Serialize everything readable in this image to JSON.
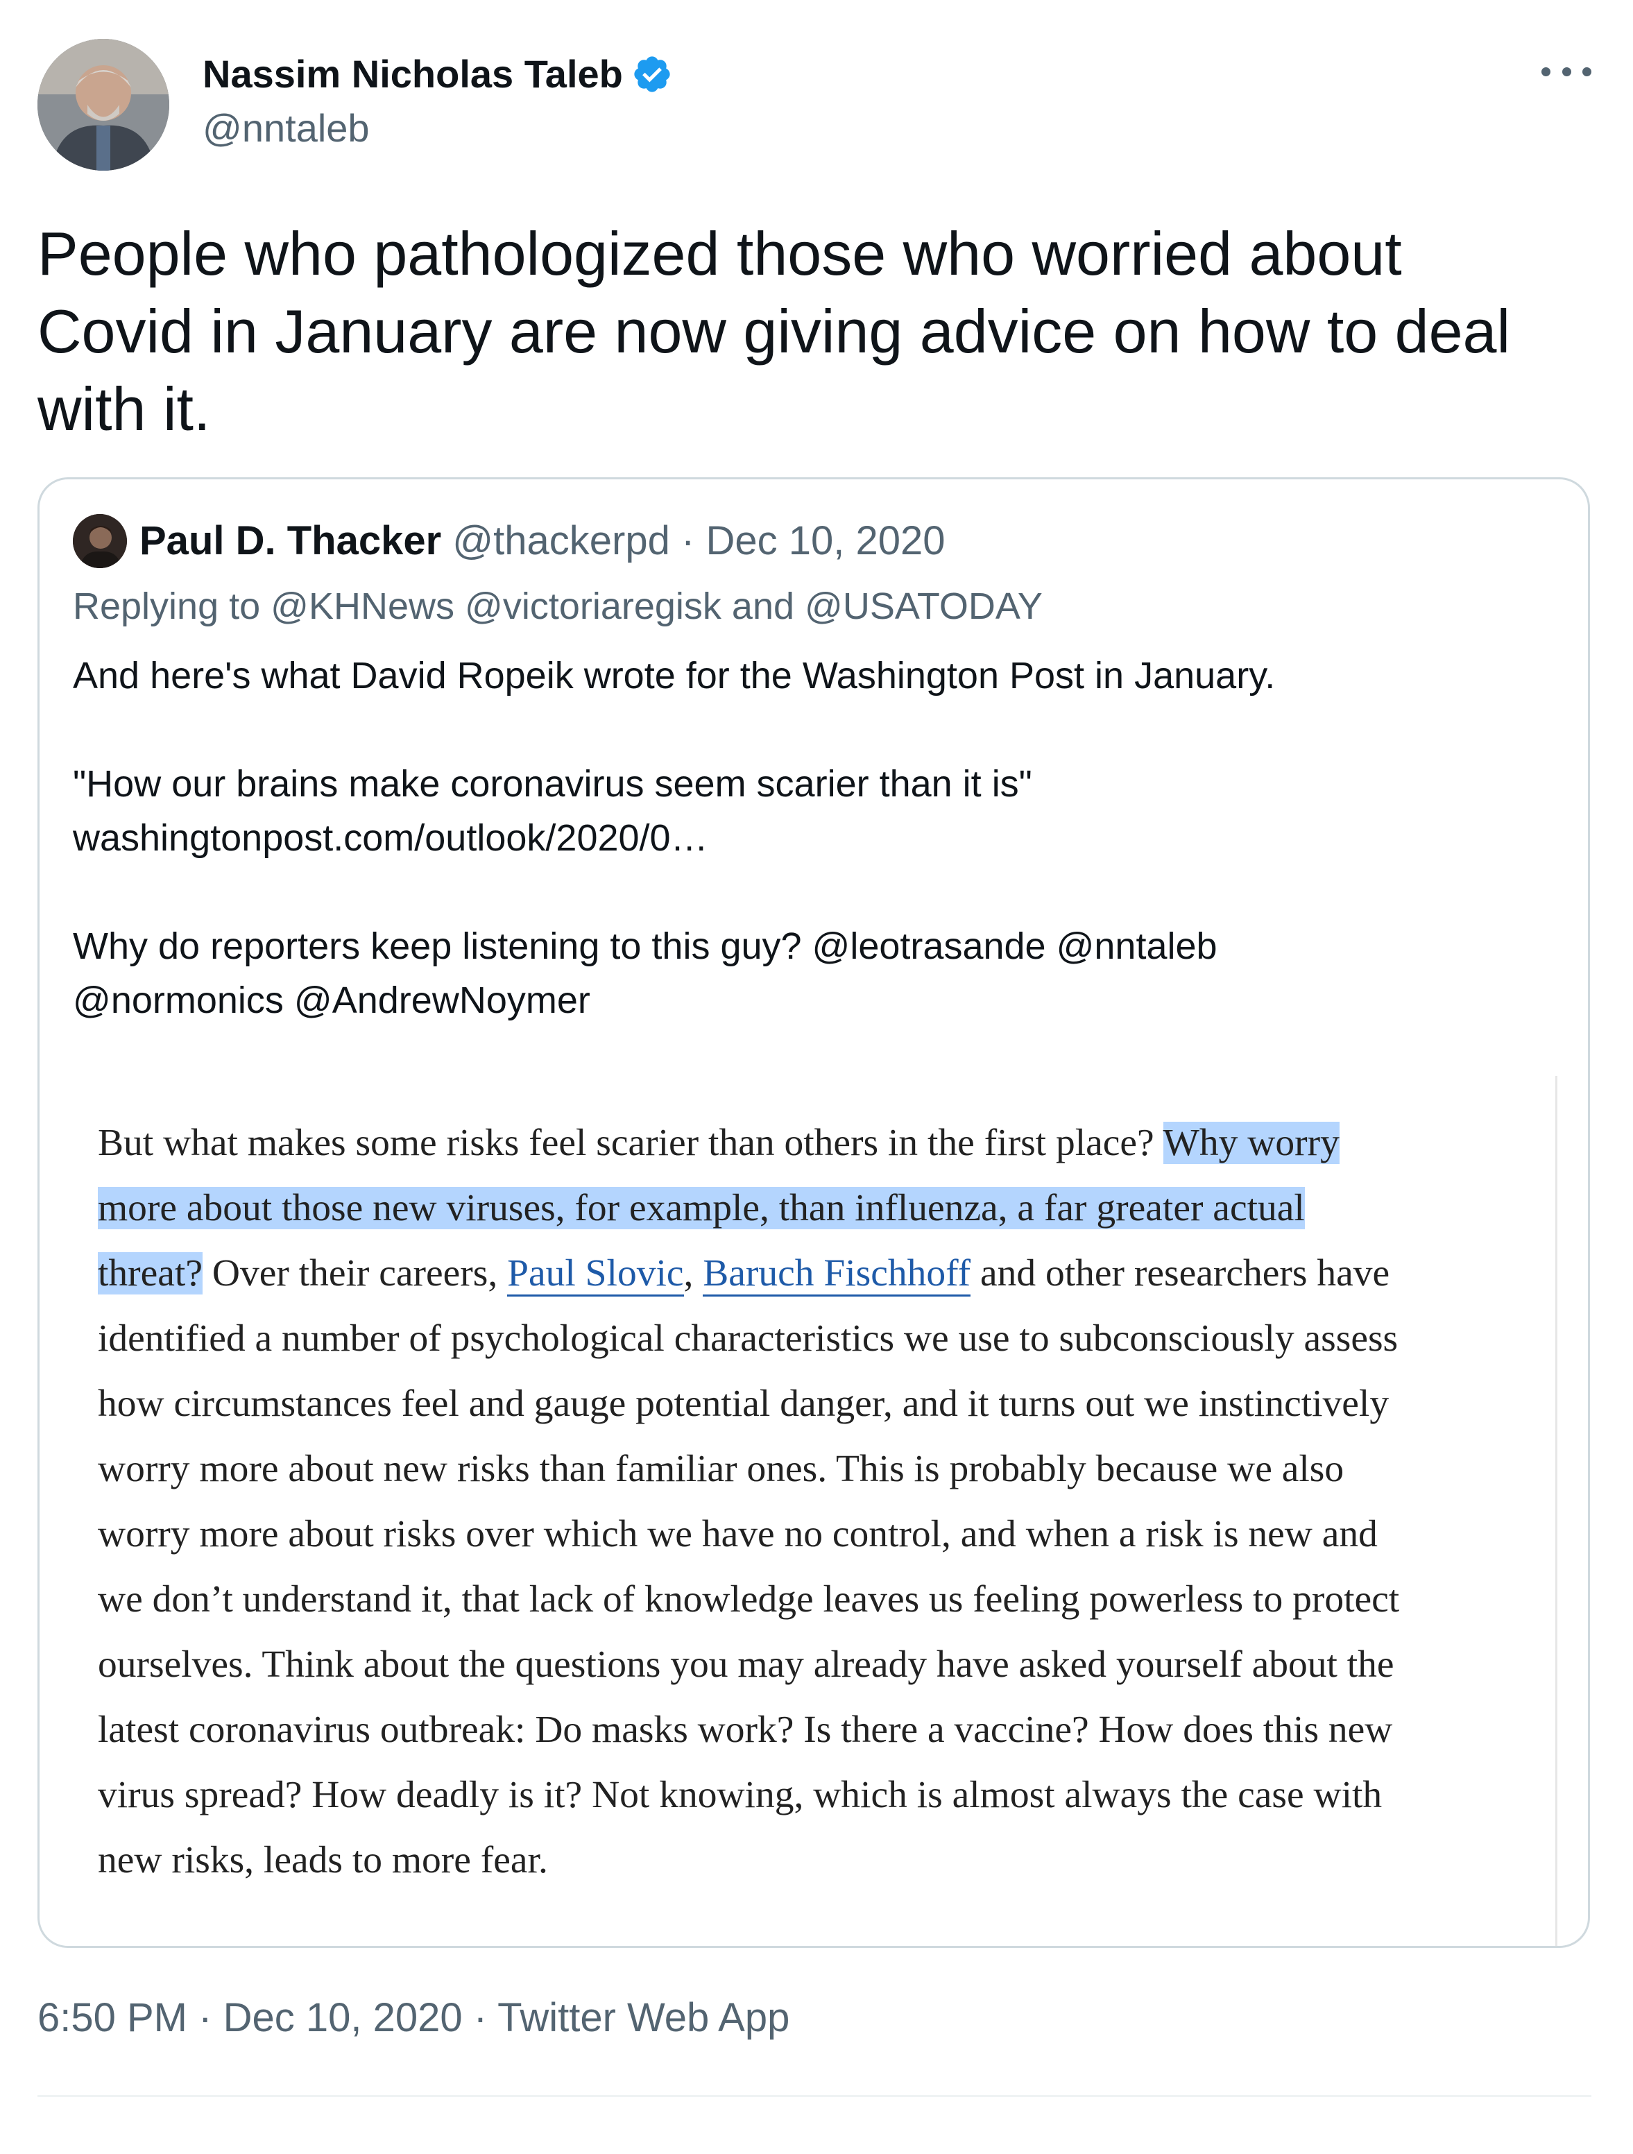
{
  "author": {
    "name": "Nassim Nicholas Taleb",
    "handle": "@nntaleb",
    "verified": true
  },
  "tweet": {
    "text_lines": [
      "People who pathologized those who worried about",
      "Covid in January are now giving advice on how to deal",
      "with it."
    ]
  },
  "quoted": {
    "name": "Paul D. Thacker",
    "handle": "@thackerpd",
    "separator": "·",
    "date": "Dec 10, 2020",
    "replying": "Replying to @KHNews @victoriaregisk and @USATODAY",
    "line1": "And here's what David Ropeik wrote for the Washington Post in January.",
    "line2": "\"How our brains make coronavirus seem scarier than it is\"",
    "line3": "washingtonpost.com/outlook/2020/0…",
    "line4": "Why do reporters keep listening to this guy? @leotrasande @nntaleb",
    "line5": "@normonics @AndrewNoymer"
  },
  "article": {
    "l1a": "But what makes some risks feel scarier than others in the first place? ",
    "l1b": "Why worry",
    "l2": "more about those new viruses, for example, than influenza, a far greater actual",
    "l3a": "threat?",
    "l3b": " Over their careers, ",
    "l3c": "Paul Slovic",
    "l3d": ", ",
    "l3e": "Baruch Fischhoff",
    "l3f": " and other researchers have",
    "l4": "identified a number of psychological characteristics we use to subconsciously assess",
    "l5": "how circumstances feel and gauge potential danger, and it turns out we instinctively",
    "l6": "worry more about new risks than familiar ones. This is probably because we also",
    "l7": "worry more about risks over which we have no control, and when a risk is new and",
    "l8": "we don’t understand it, that lack of knowledge leaves us feeling powerless to protect",
    "l9": "ourselves. Think about the questions you may already have asked yourself about the",
    "l10": "latest coronavirus outbreak: Do masks work? Is there a vaccine? How does this new",
    "l11": "virus spread? How deadly is it? Not knowing, which is almost always the case with",
    "l12": "new risks, leads to more fear."
  },
  "meta": {
    "time": "6:50 PM",
    "dot1": "·",
    "date": "Dec 10, 2020",
    "dot2": "·",
    "source": "Twitter Web App"
  },
  "colors": {
    "verified": "#1d9bf0",
    "secondary_text": "#536471",
    "highlight": "#b4d5fe",
    "article_link": "#1e5aa8"
  },
  "icons": [
    "verified-badge-icon",
    "more-options-icon"
  ]
}
